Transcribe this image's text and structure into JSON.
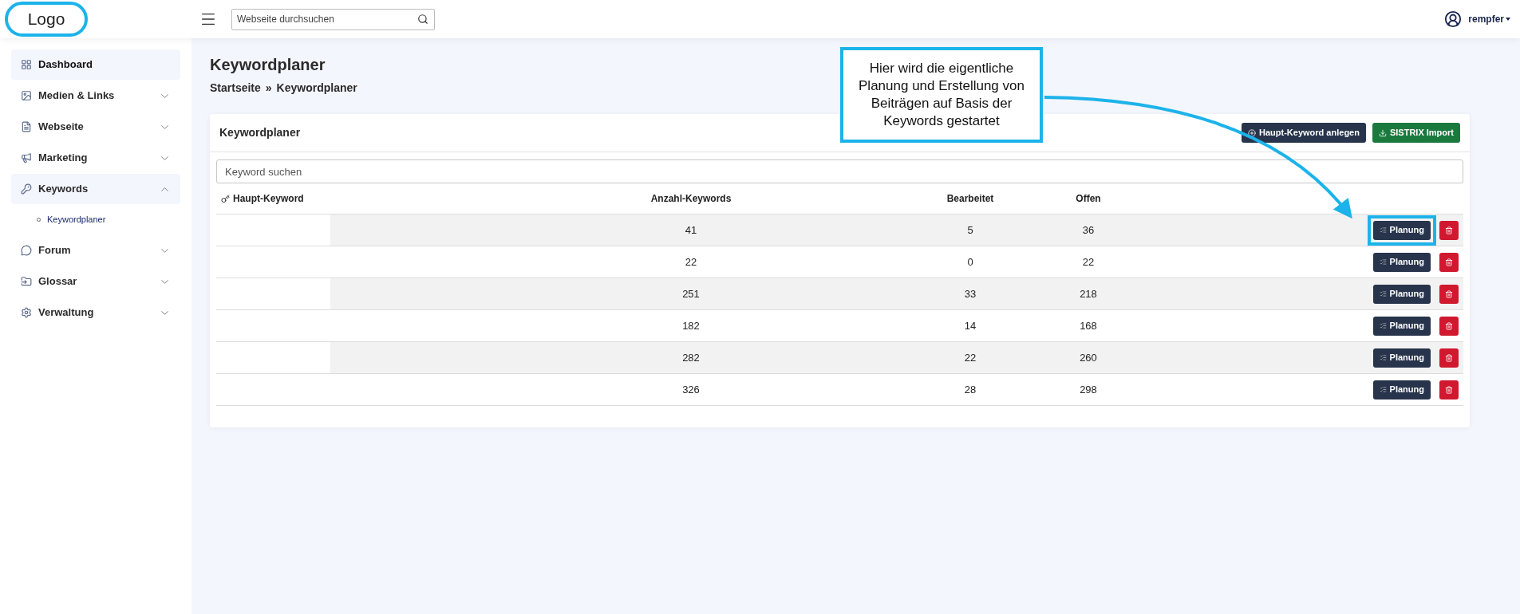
{
  "logo": {
    "text": "Logo"
  },
  "header": {
    "search_placeholder": "Webseite durchsuchen",
    "user": "rempfer"
  },
  "sidebar": {
    "items": [
      {
        "label": "Dashboard",
        "selected": true
      },
      {
        "label": "Medien & Links",
        "selected": false,
        "expanded": false
      },
      {
        "label": "Webseite",
        "selected": false,
        "expanded": false
      },
      {
        "label": "Marketing",
        "selected": false,
        "expanded": false
      },
      {
        "label": "Keywords",
        "selected": false,
        "expanded": true,
        "children": [
          {
            "label": "Keywordplaner",
            "selected": true
          }
        ]
      },
      {
        "label": "Forum",
        "selected": false,
        "expanded": false
      },
      {
        "label": "Glossar",
        "selected": false,
        "expanded": false
      },
      {
        "label": "Verwaltung",
        "selected": false,
        "expanded": false
      }
    ]
  },
  "page": {
    "title": "Keywordplaner",
    "breadcrumb": [
      "Startseite",
      "»",
      "Keywordplaner"
    ]
  },
  "card": {
    "title": "Keywordplaner",
    "buttons": [
      {
        "label": "Haupt-Keyword anlegen",
        "kind": "primary"
      },
      {
        "label": "SISTRIX Import",
        "kind": "success"
      }
    ],
    "search_placeholder": "Keyword suchen",
    "columns": [
      "Haupt-Keyword",
      "Anzahl-Keywords",
      "Bearbeitet",
      "Offen"
    ],
    "rows": [
      {
        "anzahl": "41",
        "bearbeitet": "5",
        "offen": "36",
        "action": "Planung",
        "highlighted": true
      },
      {
        "anzahl": "22",
        "bearbeitet": "0",
        "offen": "22",
        "action": "Planung",
        "highlighted": false
      },
      {
        "anzahl": "251",
        "bearbeitet": "33",
        "offen": "218",
        "action": "Planung",
        "highlighted": false
      },
      {
        "anzahl": "182",
        "bearbeitet": "14",
        "offen": "168",
        "action": "Planung",
        "highlighted": false
      },
      {
        "anzahl": "282",
        "bearbeitet": "22",
        "offen": "260",
        "action": "Planung",
        "highlighted": false
      },
      {
        "anzahl": "326",
        "bearbeitet": "28",
        "offen": "298",
        "action": "Planung",
        "highlighted": false
      }
    ]
  },
  "annotation": {
    "text": "Hier wird die eigentliche Planung und Erstellung von Beiträgen auf Basis der Keywords gestartet"
  }
}
